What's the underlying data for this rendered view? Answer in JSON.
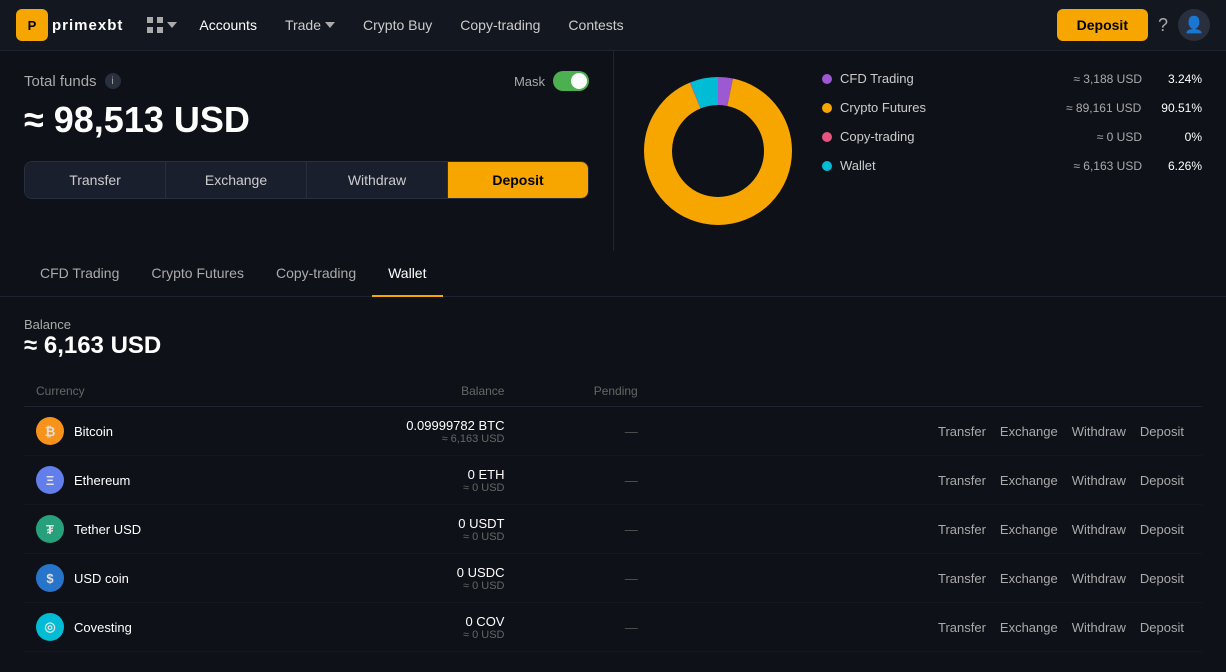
{
  "app": {
    "logo_text": "PrimeXBT",
    "logo_initial": "P"
  },
  "nav": {
    "apps_label": "⊞",
    "accounts_label": "Accounts",
    "trade_label": "Trade",
    "buy_crypto_label": "Crypto Buy",
    "copy_trading_label": "Copy-trading",
    "contests_label": "Contests",
    "deposit_btn": "Deposit"
  },
  "total_funds": {
    "label": "Total funds",
    "mask_label": "Mask",
    "amount": "≈ 98,513 USD"
  },
  "action_buttons": {
    "transfer": "Transfer",
    "exchange": "Exchange",
    "withdraw": "Withdraw",
    "deposit": "Deposit"
  },
  "donut": {
    "segments": [
      {
        "label": "CFD Trading",
        "color": "#9c59d1",
        "pct": 3.24,
        "usd": "≈ 3,188 USD",
        "pct_label": "3.24%"
      },
      {
        "label": "Crypto Futures",
        "color": "#f7a600",
        "pct": 90.51,
        "usd": "≈ 89,161 USD",
        "pct_label": "90.51%"
      },
      {
        "label": "Copy-trading",
        "color": "#e75480",
        "pct": 0,
        "usd": "≈ 0 USD",
        "pct_label": "0%"
      },
      {
        "label": "Wallet",
        "color": "#00bcd4",
        "pct": 6.26,
        "usd": "≈ 6,163 USD",
        "pct_label": "6.26%"
      }
    ]
  },
  "tabs": [
    {
      "id": "cfd",
      "label": "CFD Trading"
    },
    {
      "id": "futures",
      "label": "Crypto Futures"
    },
    {
      "id": "copytrading",
      "label": "Copy-trading"
    },
    {
      "id": "wallet",
      "label": "Wallet",
      "active": true
    }
  ],
  "wallet": {
    "balance_label": "Balance",
    "balance_value": "≈ 6,163 USD",
    "table": {
      "headers": {
        "currency": "Currency",
        "balance": "Balance",
        "pending": "Pending"
      },
      "rows": [
        {
          "name": "Bitcoin",
          "symbol": "BTC",
          "icon_bg": "#f7931a",
          "icon_text": "₿",
          "balance_main": "0.09999782 BTC",
          "balance_usd": "≈ 6,163 USD",
          "pending": "—"
        },
        {
          "name": "Ethereum",
          "symbol": "ETH",
          "icon_bg": "#627eea",
          "icon_text": "Ξ",
          "balance_main": "0 ETH",
          "balance_usd": "≈ 0 USD",
          "pending": "—"
        },
        {
          "name": "Tether USD",
          "symbol": "USDT",
          "icon_bg": "#26a17b",
          "icon_text": "₮",
          "balance_main": "0 USDT",
          "balance_usd": "≈ 0 USD",
          "pending": "—"
        },
        {
          "name": "USD coin",
          "symbol": "USDC",
          "icon_bg": "#2775ca",
          "icon_text": "$",
          "balance_main": "0 USDC",
          "balance_usd": "≈ 0 USD",
          "pending": "—"
        },
        {
          "name": "Covesting",
          "symbol": "COV",
          "icon_bg": "#00bcd4",
          "icon_text": "◎",
          "balance_main": "0 COV",
          "balance_usd": "≈ 0 USD",
          "pending": "—"
        }
      ],
      "row_actions": [
        "Transfer",
        "Exchange",
        "Withdraw",
        "Deposit"
      ]
    }
  }
}
